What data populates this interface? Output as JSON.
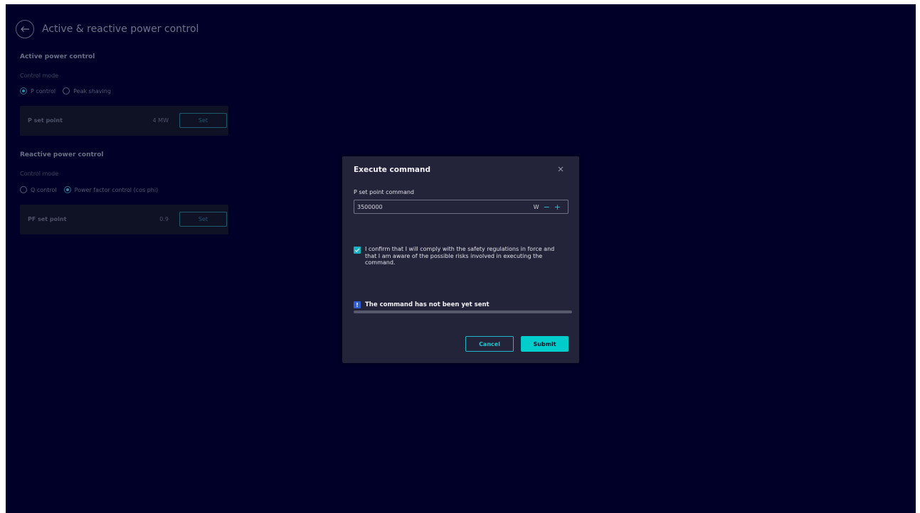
{
  "page": {
    "title": "Active & reactive power control"
  },
  "active_power": {
    "section_title": "Active power control",
    "mode_label": "Control mode",
    "options": [
      {
        "label": "P control",
        "selected": true
      },
      {
        "label": "Peak shaving",
        "selected": false
      }
    ],
    "setpoint": {
      "label": "P set point",
      "value": "4 MW",
      "button": "Set"
    }
  },
  "reactive_power": {
    "section_title": "Reactive power control",
    "mode_label": "Control mode",
    "options": [
      {
        "label": "Q control",
        "selected": false
      },
      {
        "label": "Power factor control (cos phi)",
        "selected": true
      }
    ],
    "setpoint": {
      "label": "PF set point",
      "value": "0.9",
      "button": "Set"
    }
  },
  "dialog": {
    "title": "Execute command",
    "field_label": "P set point command",
    "field_value": "3500000",
    "unit": "W",
    "decrement": "−",
    "increment": "+",
    "confirm_checked": true,
    "confirm_text": "I confirm that I will comply with the safety regulations in force and that I am aware of the possible risks involved in executing the command.",
    "status_badge": "!",
    "status_text": "The command has not been yet sent",
    "progress": 0,
    "cancel_label": "Cancel",
    "submit_label": "Submit"
  },
  "colors": {
    "background": "#000028",
    "dialog": "#23233a",
    "accent": "#00cccc",
    "info": "#2f5fcf"
  },
  "icons": {
    "back": "arrow-left-circle-icon",
    "close": "close-icon",
    "check": "checkmark-icon",
    "info": "exclamation-icon"
  }
}
